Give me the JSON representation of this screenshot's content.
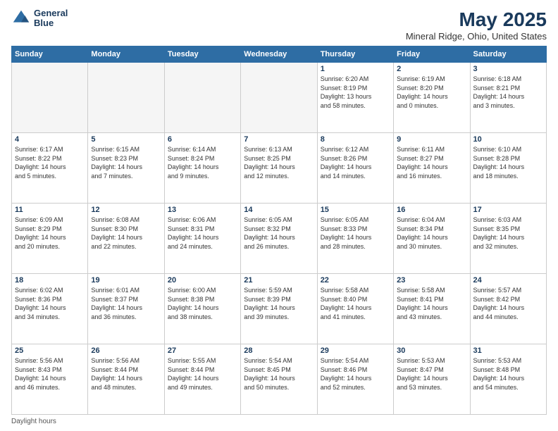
{
  "header": {
    "logo_line1": "General",
    "logo_line2": "Blue",
    "title": "May 2025",
    "subtitle": "Mineral Ridge, Ohio, United States"
  },
  "days_of_week": [
    "Sunday",
    "Monday",
    "Tuesday",
    "Wednesday",
    "Thursday",
    "Friday",
    "Saturday"
  ],
  "footer": {
    "note": "Daylight hours"
  },
  "weeks": [
    {
      "days": [
        {
          "num": "",
          "info": "",
          "empty": true
        },
        {
          "num": "",
          "info": "",
          "empty": true
        },
        {
          "num": "",
          "info": "",
          "empty": true
        },
        {
          "num": "",
          "info": "",
          "empty": true
        },
        {
          "num": "1",
          "info": "Sunrise: 6:20 AM\nSunset: 8:19 PM\nDaylight: 13 hours\nand 58 minutes.",
          "empty": false
        },
        {
          "num": "2",
          "info": "Sunrise: 6:19 AM\nSunset: 8:20 PM\nDaylight: 14 hours\nand 0 minutes.",
          "empty": false
        },
        {
          "num": "3",
          "info": "Sunrise: 6:18 AM\nSunset: 8:21 PM\nDaylight: 14 hours\nand 3 minutes.",
          "empty": false
        }
      ]
    },
    {
      "days": [
        {
          "num": "4",
          "info": "Sunrise: 6:17 AM\nSunset: 8:22 PM\nDaylight: 14 hours\nand 5 minutes.",
          "empty": false
        },
        {
          "num": "5",
          "info": "Sunrise: 6:15 AM\nSunset: 8:23 PM\nDaylight: 14 hours\nand 7 minutes.",
          "empty": false
        },
        {
          "num": "6",
          "info": "Sunrise: 6:14 AM\nSunset: 8:24 PM\nDaylight: 14 hours\nand 9 minutes.",
          "empty": false
        },
        {
          "num": "7",
          "info": "Sunrise: 6:13 AM\nSunset: 8:25 PM\nDaylight: 14 hours\nand 12 minutes.",
          "empty": false
        },
        {
          "num": "8",
          "info": "Sunrise: 6:12 AM\nSunset: 8:26 PM\nDaylight: 14 hours\nand 14 minutes.",
          "empty": false
        },
        {
          "num": "9",
          "info": "Sunrise: 6:11 AM\nSunset: 8:27 PM\nDaylight: 14 hours\nand 16 minutes.",
          "empty": false
        },
        {
          "num": "10",
          "info": "Sunrise: 6:10 AM\nSunset: 8:28 PM\nDaylight: 14 hours\nand 18 minutes.",
          "empty": false
        }
      ]
    },
    {
      "days": [
        {
          "num": "11",
          "info": "Sunrise: 6:09 AM\nSunset: 8:29 PM\nDaylight: 14 hours\nand 20 minutes.",
          "empty": false
        },
        {
          "num": "12",
          "info": "Sunrise: 6:08 AM\nSunset: 8:30 PM\nDaylight: 14 hours\nand 22 minutes.",
          "empty": false
        },
        {
          "num": "13",
          "info": "Sunrise: 6:06 AM\nSunset: 8:31 PM\nDaylight: 14 hours\nand 24 minutes.",
          "empty": false
        },
        {
          "num": "14",
          "info": "Sunrise: 6:05 AM\nSunset: 8:32 PM\nDaylight: 14 hours\nand 26 minutes.",
          "empty": false
        },
        {
          "num": "15",
          "info": "Sunrise: 6:05 AM\nSunset: 8:33 PM\nDaylight: 14 hours\nand 28 minutes.",
          "empty": false
        },
        {
          "num": "16",
          "info": "Sunrise: 6:04 AM\nSunset: 8:34 PM\nDaylight: 14 hours\nand 30 minutes.",
          "empty": false
        },
        {
          "num": "17",
          "info": "Sunrise: 6:03 AM\nSunset: 8:35 PM\nDaylight: 14 hours\nand 32 minutes.",
          "empty": false
        }
      ]
    },
    {
      "days": [
        {
          "num": "18",
          "info": "Sunrise: 6:02 AM\nSunset: 8:36 PM\nDaylight: 14 hours\nand 34 minutes.",
          "empty": false
        },
        {
          "num": "19",
          "info": "Sunrise: 6:01 AM\nSunset: 8:37 PM\nDaylight: 14 hours\nand 36 minutes.",
          "empty": false
        },
        {
          "num": "20",
          "info": "Sunrise: 6:00 AM\nSunset: 8:38 PM\nDaylight: 14 hours\nand 38 minutes.",
          "empty": false
        },
        {
          "num": "21",
          "info": "Sunrise: 5:59 AM\nSunset: 8:39 PM\nDaylight: 14 hours\nand 39 minutes.",
          "empty": false
        },
        {
          "num": "22",
          "info": "Sunrise: 5:58 AM\nSunset: 8:40 PM\nDaylight: 14 hours\nand 41 minutes.",
          "empty": false
        },
        {
          "num": "23",
          "info": "Sunrise: 5:58 AM\nSunset: 8:41 PM\nDaylight: 14 hours\nand 43 minutes.",
          "empty": false
        },
        {
          "num": "24",
          "info": "Sunrise: 5:57 AM\nSunset: 8:42 PM\nDaylight: 14 hours\nand 44 minutes.",
          "empty": false
        }
      ]
    },
    {
      "days": [
        {
          "num": "25",
          "info": "Sunrise: 5:56 AM\nSunset: 8:43 PM\nDaylight: 14 hours\nand 46 minutes.",
          "empty": false
        },
        {
          "num": "26",
          "info": "Sunrise: 5:56 AM\nSunset: 8:44 PM\nDaylight: 14 hours\nand 48 minutes.",
          "empty": false
        },
        {
          "num": "27",
          "info": "Sunrise: 5:55 AM\nSunset: 8:44 PM\nDaylight: 14 hours\nand 49 minutes.",
          "empty": false
        },
        {
          "num": "28",
          "info": "Sunrise: 5:54 AM\nSunset: 8:45 PM\nDaylight: 14 hours\nand 50 minutes.",
          "empty": false
        },
        {
          "num": "29",
          "info": "Sunrise: 5:54 AM\nSunset: 8:46 PM\nDaylight: 14 hours\nand 52 minutes.",
          "empty": false
        },
        {
          "num": "30",
          "info": "Sunrise: 5:53 AM\nSunset: 8:47 PM\nDaylight: 14 hours\nand 53 minutes.",
          "empty": false
        },
        {
          "num": "31",
          "info": "Sunrise: 5:53 AM\nSunset: 8:48 PM\nDaylight: 14 hours\nand 54 minutes.",
          "empty": false
        }
      ]
    }
  ]
}
